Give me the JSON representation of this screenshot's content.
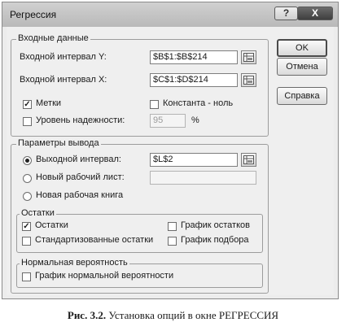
{
  "window": {
    "title": "Регрессия",
    "help_label": "?",
    "close_label": "X"
  },
  "input": {
    "group_title": "Входные данные",
    "y_range_label": "Входной интервал Y:",
    "y_range_value": "$B$1:$B$214",
    "x_range_label": "Входной интервал X:",
    "x_range_value": "$C$1:$D$214",
    "labels_label": "Метки",
    "labels_checked": true,
    "constant_zero_label": "Константа - ноль",
    "constant_zero_checked": false,
    "confidence_label": "Уровень надежности:",
    "confidence_checked": false,
    "confidence_value": "95",
    "percent_sign": "%"
  },
  "output": {
    "group_title": "Параметры вывода",
    "output_range_label": "Выходной интервал:",
    "output_range_value": "$L$2",
    "output_range_selected": true,
    "new_sheet_label": "Новый рабочий лист:",
    "new_sheet_value": "",
    "new_workbook_label": "Новая рабочая книга"
  },
  "residuals": {
    "group_title": "Остатки",
    "residuals_label": "Остатки",
    "residuals_checked": true,
    "standardized_label": "Стандартизованные остатки",
    "residual_plot_label": "График остатков",
    "line_fit_label": "График подбора"
  },
  "normal": {
    "group_title": "Нормальная вероятность",
    "normal_plot_label": "График нормальной вероятности"
  },
  "buttons": {
    "ok": "OK",
    "cancel": "Отмена",
    "help": "Справка"
  },
  "caption": {
    "bold": "Рис. 3.2.",
    "text": " Установка опций в окне РЕГРЕССИЯ"
  }
}
